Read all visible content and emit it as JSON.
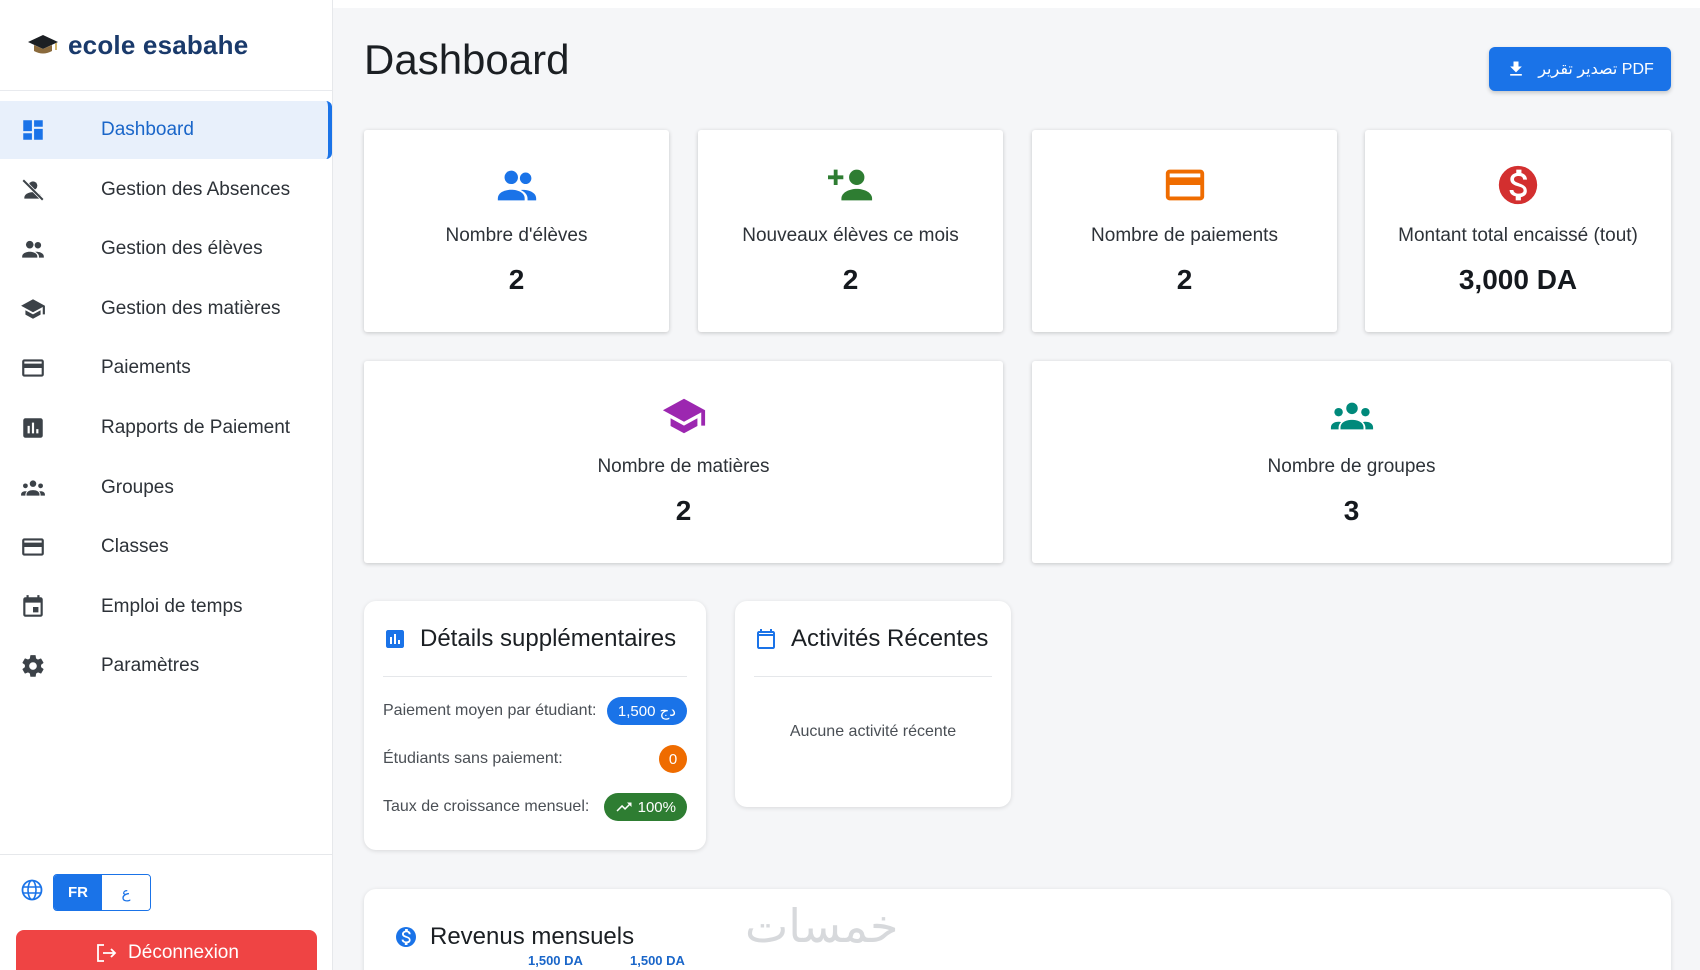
{
  "app": {
    "name": "ecole esabahe",
    "logo_icon": "graduation-cap-icon"
  },
  "sidebar": {
    "items": [
      {
        "label": "Dashboard",
        "icon": "dashboard-icon",
        "active": true
      },
      {
        "label": "Gestion des Absences",
        "icon": "person-off-icon"
      },
      {
        "label": "Gestion des élèves",
        "icon": "people-icon"
      },
      {
        "label": "Gestion des matières",
        "icon": "school-icon"
      },
      {
        "label": "Paiements",
        "icon": "credit-card-icon"
      },
      {
        "label": "Rapports de Paiement",
        "icon": "bar-chart-icon"
      },
      {
        "label": "Groupes",
        "icon": "groups-icon"
      },
      {
        "label": "Classes",
        "icon": "card-icon"
      },
      {
        "label": "Emploi de temps",
        "icon": "calendar-icon"
      },
      {
        "label": "Paramètres",
        "icon": "gear-icon"
      }
    ],
    "language": {
      "current": "FR",
      "other": "ع"
    },
    "logout_label": "Déconnexion"
  },
  "header": {
    "title": "Dashboard",
    "export_label": "تصدير تقرير PDF"
  },
  "stats": [
    {
      "label": "Nombre d'élèves",
      "value": "2",
      "icon": "people-icon",
      "color": "#1a73e8"
    },
    {
      "label": "Nouveaux élèves ce mois",
      "value": "2",
      "icon": "person-add-icon",
      "color": "#2e7d32"
    },
    {
      "label": "Nombre de paiements",
      "value": "2",
      "icon": "credit-card-icon",
      "color": "#ef6c00"
    },
    {
      "label": "Montant total encaissé (tout)",
      "value": "3,000 DA",
      "icon": "dollar-icon",
      "color": "#d32f2f"
    },
    {
      "label": "Nombre de matières",
      "value": "2",
      "icon": "school-icon",
      "color": "#9c27b0"
    },
    {
      "label": "Nombre de groupes",
      "value": "3",
      "icon": "groups-icon",
      "color": "#00897b"
    }
  ],
  "details": {
    "title": "Détails supplémentaires",
    "rows": [
      {
        "label": "Paiement moyen par étudiant:",
        "value": "1,500 دج",
        "color": "#1a73e8"
      },
      {
        "label": "Étudiants sans paiement:",
        "value": "0",
        "color": "#ef6c00"
      },
      {
        "label": "Taux de croissance mensuel:",
        "value": "100%",
        "color": "#2e7d32",
        "icon": "trending-up-icon"
      }
    ]
  },
  "activities": {
    "title": "Activités Récentes",
    "empty": "Aucune activité récente"
  },
  "revenue": {
    "title": "Revenus mensuels",
    "ticks": [
      "1,500 DA",
      "1,500 DA"
    ]
  },
  "watermark": "خمسات"
}
